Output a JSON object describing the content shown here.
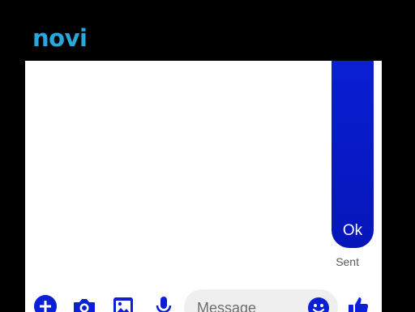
{
  "app": {
    "brand": "novi"
  },
  "thread": {
    "messages": [
      {
        "text": "Ok",
        "direction": "outgoing"
      }
    ],
    "status": "Sent"
  },
  "composer": {
    "placeholder": "Message",
    "actions": [
      "plus-icon",
      "camera-icon",
      "gallery-icon",
      "microphone-icon",
      "emoji-icon",
      "thumbs-up-icon"
    ]
  },
  "colors": {
    "brand": "#29a6dc",
    "bubble": "#0a1fd6",
    "icons": "#0a1fd6"
  }
}
